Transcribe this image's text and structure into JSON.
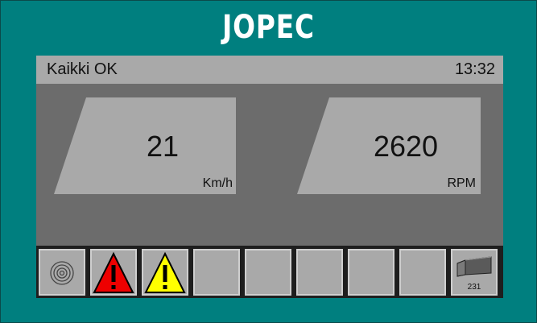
{
  "brand": "JOPEC",
  "status": {
    "message": "Kaikki OK",
    "time": "13:32"
  },
  "gauges": [
    {
      "value": "21",
      "unit": "Km/h"
    },
    {
      "value": "2620",
      "unit": "RPM"
    }
  ],
  "iconbar": {
    "slots": [
      {
        "icon": "spiral-icon"
      },
      {
        "icon": "warning-red-icon"
      },
      {
        "icon": "warning-yellow-icon"
      },
      {
        "icon": "empty"
      },
      {
        "icon": "empty"
      },
      {
        "icon": "empty"
      },
      {
        "icon": "empty"
      },
      {
        "icon": "empty"
      },
      {
        "icon": "blade-icon",
        "count": "231"
      }
    ]
  },
  "colors": {
    "frame": "#007f7f",
    "screen": "#6c6c6c",
    "panel": "#a9a9a9",
    "warning_red": "#ee0000",
    "warning_yellow": "#ffff00"
  }
}
